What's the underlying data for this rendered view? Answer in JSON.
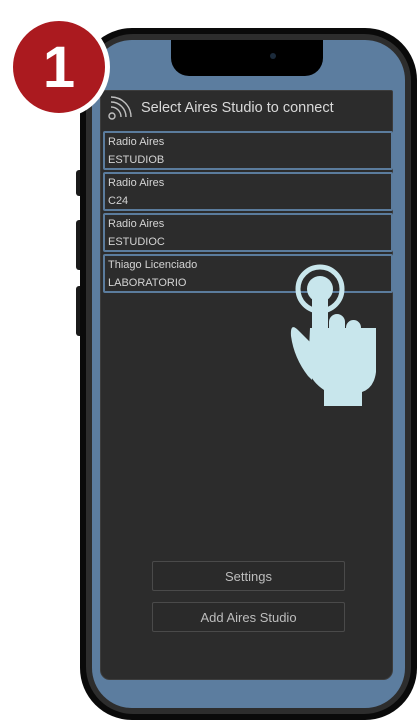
{
  "step_badge": "1",
  "app": {
    "header_title": "Select Aires Studio to connect",
    "header_icon": "signal-icon",
    "studios": [
      {
        "line1": "Radio Aires",
        "line2": "ESTUDIOB"
      },
      {
        "line1": "Radio Aires",
        "line2": "C24"
      },
      {
        "line1": "Radio Aires",
        "line2": "ESTUDIOC"
      },
      {
        "line1": "Thiago Licenciado",
        "line2": "LABORATORIO"
      }
    ],
    "settings_label": "Settings",
    "add_studio_label": "Add Aires Studio"
  },
  "overlay": {
    "icon": "tap-hand-icon"
  },
  "colors": {
    "badge": "#ab1a1f",
    "phone_frame": "#0a0a0a",
    "screen_bezel": "#5c7d9f",
    "app_background": "#2c2c2c",
    "item_border": "#5b7c9d",
    "hand": "#c8e6ec"
  }
}
